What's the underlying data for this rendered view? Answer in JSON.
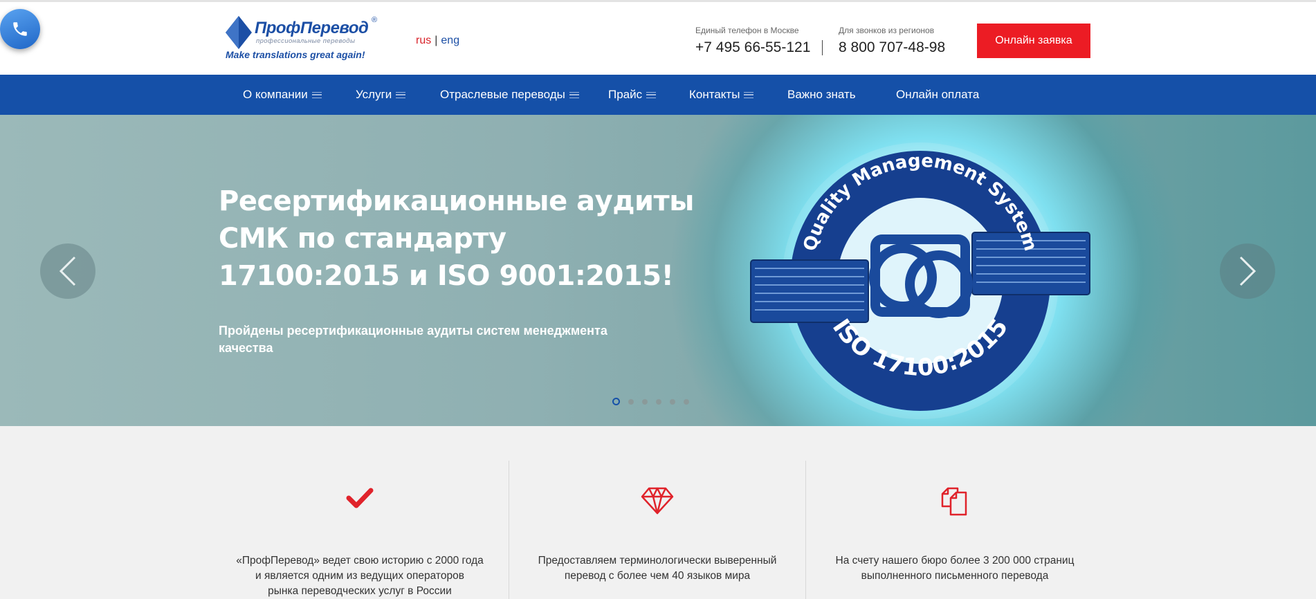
{
  "header": {
    "logo": {
      "name": "ПрофПеревод",
      "reg_mark": "®",
      "subtitle": "профессиональные переводы",
      "slogan": "Make translations great again!"
    },
    "lang": {
      "rus": "rus",
      "separator": "|",
      "eng": "eng"
    },
    "phone_moscow": {
      "label": "Единый телефон в Москве",
      "number": "+7 495 66-55-121"
    },
    "phone_regions": {
      "label": "Для звонков из регионов",
      "number": "8 800 707-48-98"
    },
    "order_button": "Онлайн заявка"
  },
  "nav": {
    "items": [
      {
        "label": "О компании",
        "has_menu": true
      },
      {
        "label": "Услуги",
        "has_menu": true
      },
      {
        "label": "Отраслевые переводы",
        "has_menu": true
      },
      {
        "label": "Прайс",
        "has_menu": true
      },
      {
        "label": "Контакты",
        "has_menu": true
      },
      {
        "label": "Важно знать",
        "has_menu": false
      },
      {
        "label": "Онлайн оплата",
        "has_menu": false
      }
    ]
  },
  "hero": {
    "title_lines": [
      "Ресертификационные аудиты",
      "СМК по стандарту",
      "17100:2015 и ISO 9001:2015!"
    ],
    "subtitle_lines": [
      "Пройдены ресертификационные аудиты систем менеджмента",
      "качества"
    ],
    "emblem": {
      "top_text": "Quality Management System",
      "bottom_text": "ISO 17100:2015"
    },
    "slides_total": 6,
    "active_slide": 1
  },
  "features": [
    {
      "icon": "checkmark-icon",
      "lines": [
        "«ПрофПеревод» ведет свою историю с 2000 года",
        "и является одним из ведущих операторов",
        "рынка переводческих услуг в России"
      ]
    },
    {
      "icon": "diamond-icon",
      "lines": [
        "Предоставляем терминологически выверенный",
        "перевод с более чем 40 языков мира"
      ]
    },
    {
      "icon": "documents-icon",
      "lines": [
        "На счету нашего бюро более 3 200 000 страниц",
        "выполненного письменного перевода"
      ]
    }
  ],
  "colors": {
    "brand_blue": "#1550a8",
    "accent_red": "#ec1c24",
    "logo_blue": "#1c4fa5"
  }
}
